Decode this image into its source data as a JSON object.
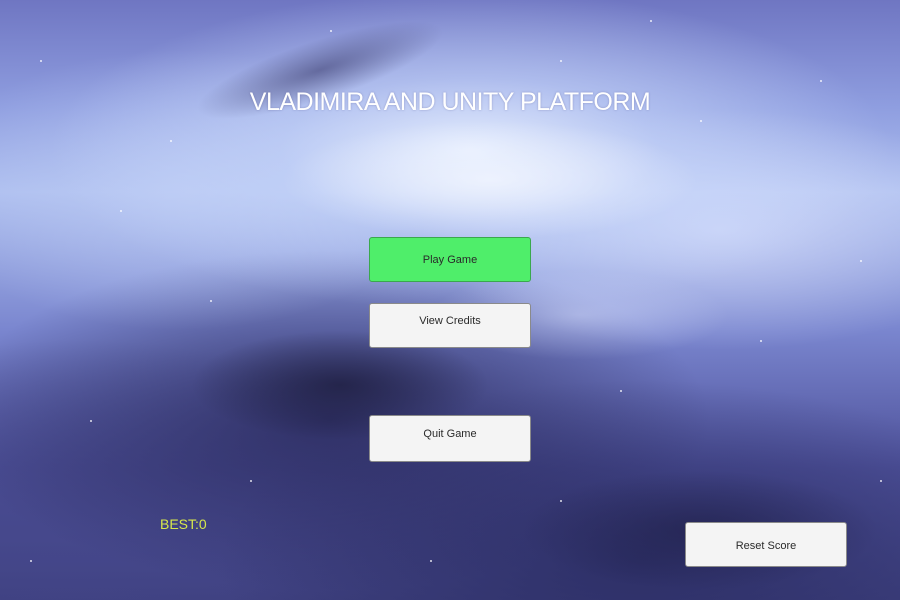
{
  "title": "VLADIMIRA AND UNITY PLATFORM",
  "menu": {
    "play_label": "Play Game",
    "credits_label": "View Credits",
    "quit_label": "Quit Game"
  },
  "score": {
    "best_text": "BEST:0",
    "reset_label": "Reset Score"
  },
  "colors": {
    "play_button": "#4fee6a",
    "button": "#f4f4f4",
    "best_text": "#d7e84a",
    "title": "#ffffff"
  }
}
